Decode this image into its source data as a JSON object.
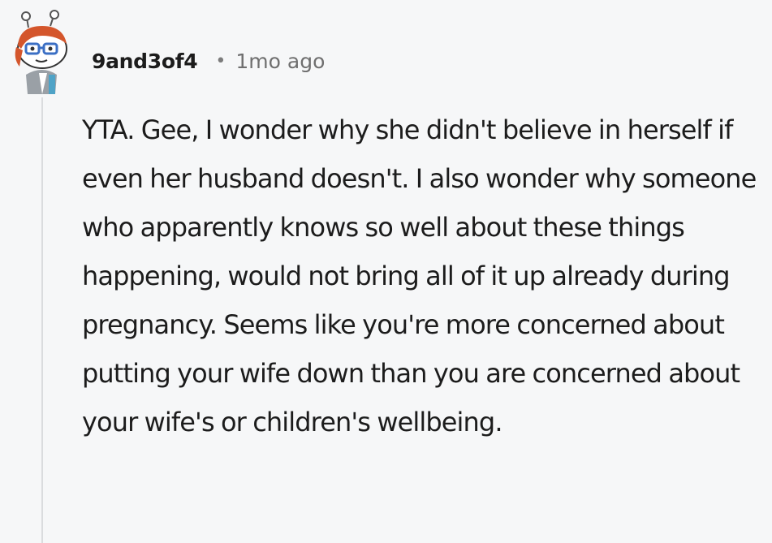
{
  "comment": {
    "author": "9and3of4",
    "separator": "•",
    "timestamp": "1mo ago",
    "avatar_icon": "snoo-avatar-icon",
    "body": "YTA. Gee, I wonder why she didn't believe in herself if even her husband doesn't. I also wonder why someone who apparently knows so well about these things happening, would not bring all of it up already during pregnancy. Seems like you're more concerned about putting your wife down than you are concerned about your wife's or children's wellbeing."
  },
  "colors": {
    "background": "#f6f7f8",
    "text": "#1c1c1c",
    "meta": "#6f6f6f",
    "thread_line": "#dadcde",
    "avatar_hair": "#d4562c",
    "avatar_glasses": "#3b6fc4"
  }
}
